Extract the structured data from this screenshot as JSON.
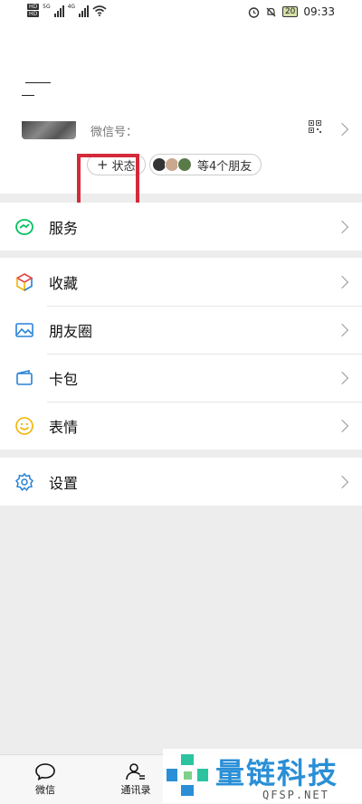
{
  "status_bar": {
    "hd1": "HD",
    "hd2": "HD",
    "net1": "5G",
    "net2": "4G",
    "battery": "20",
    "time": "09:33"
  },
  "profile": {
    "wechat_id_label": "微信号：",
    "status_button": "状态",
    "friends_label": "等4个朋友"
  },
  "menu": {
    "services": "服务",
    "favorites": "收藏",
    "moments": "朋友圈",
    "cards": "卡包",
    "stickers": "表情",
    "settings": "设置"
  },
  "tabs": {
    "chats": "微信",
    "contacts": "通讯录"
  },
  "watermark": {
    "title": "量链科技",
    "subtitle": "QFSP.NET"
  },
  "colors": {
    "highlight": "#d42a3a",
    "wechat_green": "#07c160",
    "icon_blue": "#2782d7",
    "sticker_yellow": "#f0b400",
    "watermark_blue": "#2a8fd6"
  }
}
